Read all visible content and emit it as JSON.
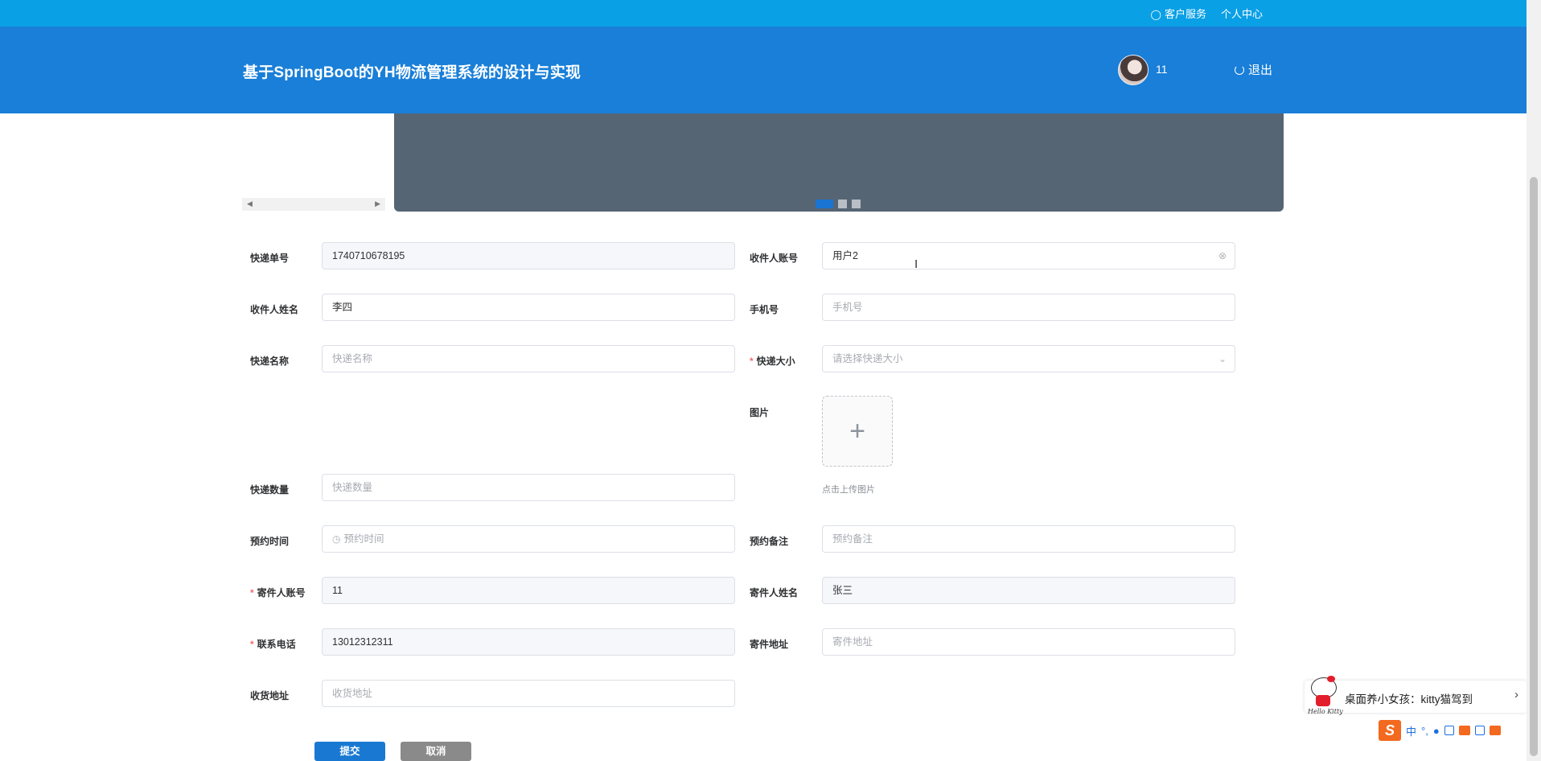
{
  "topbar": {
    "service_label": "客户服务",
    "profile_label": "个人中心"
  },
  "header": {
    "title": "基于SpringBoot的YH物流管理系统的设计与实现",
    "username": "11",
    "logout_label": "退出"
  },
  "banner": {
    "dot_count": 3,
    "active_dot": 1
  },
  "form": {
    "tracking_no": {
      "label": "快递单号",
      "value": "1740710678195"
    },
    "receiver_account": {
      "label": "收件人账号",
      "value": "用户2"
    },
    "receiver_name": {
      "label": "收件人姓名",
      "value": "李四"
    },
    "phone": {
      "label": "手机号",
      "placeholder": "手机号"
    },
    "express_name": {
      "label": "快递名称",
      "placeholder": "快递名称"
    },
    "express_size": {
      "label": "快递大小",
      "required": "*",
      "placeholder": "请选择快递大小"
    },
    "image": {
      "label": "图片",
      "plus": "+",
      "tip": "点击上传图片"
    },
    "express_qty": {
      "label": "快递数量",
      "placeholder": "快递数量"
    },
    "appointment_time": {
      "label": "预约时间",
      "placeholder": "预约时间"
    },
    "appointment_note": {
      "label": "预约备注",
      "placeholder": "预约备注"
    },
    "sender_account": {
      "label": "寄件人账号",
      "required": "*",
      "value": "11"
    },
    "sender_name": {
      "label": "寄件人姓名",
      "value": "张三"
    },
    "contact_phone": {
      "label": "联系电话",
      "required": "*",
      "value": "13012312311"
    },
    "sender_address": {
      "label": "寄件地址",
      "placeholder": "寄件地址"
    },
    "receive_address": {
      "label": "收货地址",
      "placeholder": "收货地址"
    },
    "submit_label": "提交",
    "cancel_label": "取消"
  },
  "notice": {
    "brand": "Hello Kitty",
    "text": "桌面养小女孩：kitty猫驾到",
    "arrow": "›",
    "close": "×"
  },
  "ime": {
    "logo": "S",
    "mode": "中",
    "punct": "°,"
  },
  "colors": {
    "topbar": "#0aa0e6",
    "header": "#197fd8",
    "submit": "#1979d2",
    "cancel": "#8a8a8a",
    "required": "#f56c6c"
  }
}
